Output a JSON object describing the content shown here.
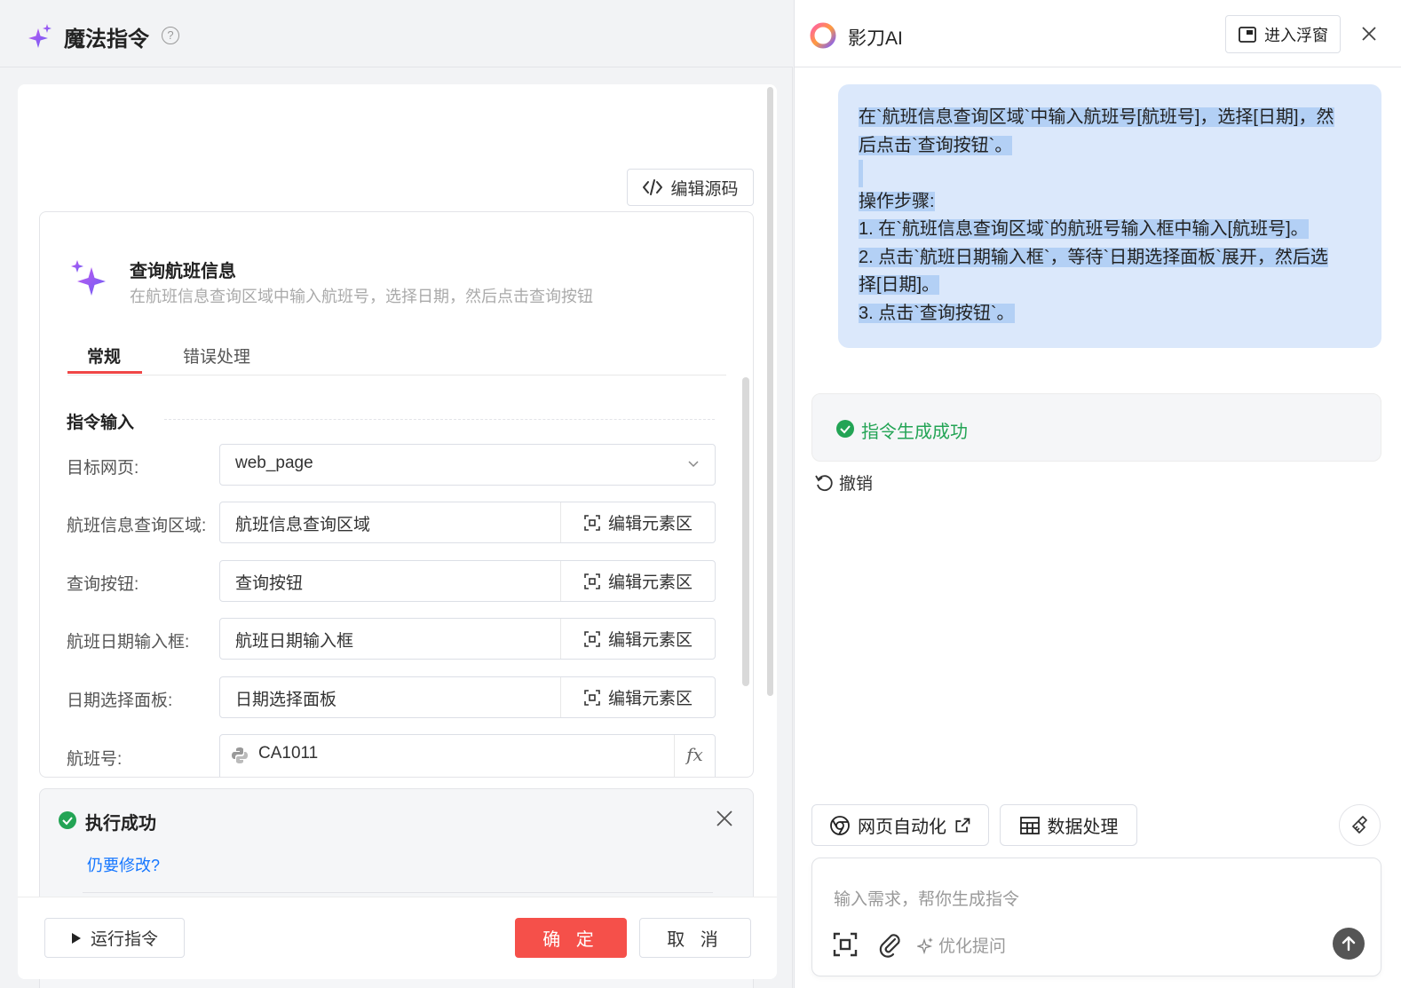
{
  "left": {
    "title": "魔法指令",
    "help_icon": "?",
    "edit_source": "编辑源码",
    "command": {
      "title": "查询航班信息",
      "description": "在航班信息查询区域中输入航班号，选择日期，然后点击查询按钮"
    },
    "tabs": [
      {
        "label": "常规",
        "active": true
      },
      {
        "label": "错误处理",
        "active": false
      }
    ],
    "section_title": "指令输入",
    "fields": [
      {
        "label": "目标网页:",
        "value": "web_page",
        "type": "select"
      },
      {
        "label": "航班信息查询区域:",
        "value": "航班信息查询区域",
        "action": "编辑元素区"
      },
      {
        "label": "查询按钮:",
        "value": "查询按钮",
        "action": "编辑元素区"
      },
      {
        "label": "航班日期输入框:",
        "value": "航班日期输入框",
        "action": "编辑元素区"
      },
      {
        "label": "日期选择面板:",
        "value": "日期选择面板",
        "action": "编辑元素区"
      },
      {
        "label": "航班号:",
        "value": "CA1011",
        "action": "fx"
      }
    ],
    "result": {
      "title": "执行成功",
      "link": "仍要修改?"
    },
    "footer": {
      "run": "运行指令",
      "ok": "确 定",
      "cancel": "取 消"
    }
  },
  "right": {
    "ai_name": "影刀AI",
    "float_button": "进入浮窗",
    "user_message": {
      "lines": [
        "在`航班信息查询区域`中输入航班号[航班号]，选择[日期]，然",
        "后点击`查询按钮`。",
        "",
        "操作步骤:",
        "1. 在`航班信息查询区域`的航班号输入框中输入[航班号]。",
        "2. 点击`航班日期输入框`，等待`日期选择面板`展开，然后选",
        "择[日期]。",
        "3. 点击`查询按钮`。"
      ]
    },
    "status": "指令生成成功",
    "undo": "撤销",
    "chips": {
      "web": "网页自动化",
      "data": "数据处理"
    },
    "input": {
      "placeholder": "输入需求，帮你生成指令",
      "optimize": "优化提问"
    }
  },
  "colors": {
    "accent_red": "#f5504a",
    "success_green": "#23a455",
    "link_blue": "#1677ff",
    "bubble_bg": "#dbe8fb",
    "star_purple": "#8b5cf6"
  }
}
